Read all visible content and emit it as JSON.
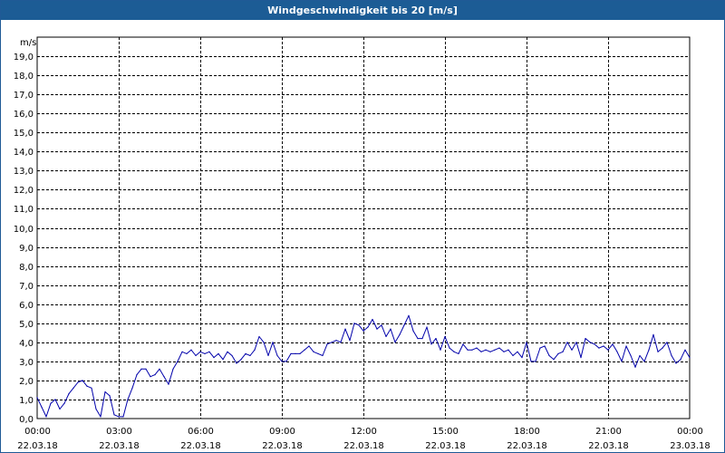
{
  "window": {
    "title": "Windgeschwindigkeit bis 20 [m/s]"
  },
  "chart_data": {
    "type": "line",
    "title": "Windgeschwindigkeit bis 20 [m/s]",
    "ylabel": "m/s",
    "xlabel": "",
    "ylim": [
      0,
      20
    ],
    "xlim": [
      "22.03.18 00:00",
      "23.03.18 00:00"
    ],
    "grid": true,
    "y_ticks": [
      "0,0",
      "1,0",
      "2,0",
      "3,0",
      "4,0",
      "5,0",
      "6,0",
      "7,0",
      "8,0",
      "9,0",
      "10,0",
      "11,0",
      "12,0",
      "13,0",
      "14,0",
      "15,0",
      "16,0",
      "17,0",
      "18,0",
      "19,0"
    ],
    "x_ticks": [
      {
        "time": "00:00",
        "date": "22.03.18"
      },
      {
        "time": "03:00",
        "date": "22.03.18"
      },
      {
        "time": "06:00",
        "date": "22.03.18"
      },
      {
        "time": "09:00",
        "date": "22.03.18"
      },
      {
        "time": "12:00",
        "date": "22.03.18"
      },
      {
        "time": "15:00",
        "date": "22.03.18"
      },
      {
        "time": "18:00",
        "date": "22.03.18"
      },
      {
        "time": "21:00",
        "date": "22.03.18"
      },
      {
        "time": "00:00",
        "date": "23.03.18"
      }
    ],
    "line_color": "#0000aa",
    "grid_color": "#000000",
    "series": [
      {
        "x": [
          "00:00",
          "00:10",
          "00:20",
          "00:30",
          "00:40",
          "00:50",
          "01:00",
          "01:10",
          "01:20",
          "01:30",
          "01:40",
          "01:50",
          "02:00",
          "02:10",
          "02:20",
          "02:30",
          "02:40",
          "02:50",
          "03:00",
          "03:10",
          "03:20",
          "03:30",
          "03:40",
          "03:50",
          "04:00",
          "04:10",
          "04:20",
          "04:30",
          "04:40",
          "04:50",
          "05:00",
          "05:10",
          "05:20",
          "05:30",
          "05:40",
          "05:50",
          "06:00",
          "06:10",
          "06:20",
          "06:30",
          "06:40",
          "06:50",
          "07:00",
          "07:10",
          "07:20",
          "07:30",
          "07:40",
          "07:50",
          "08:00",
          "08:10",
          "08:20",
          "08:30",
          "08:40",
          "08:50",
          "09:00",
          "09:10",
          "09:20",
          "09:30",
          "09:40",
          "09:50",
          "10:00",
          "10:10",
          "10:20",
          "10:30",
          "10:40",
          "10:50",
          "11:00",
          "11:10",
          "11:20",
          "11:30",
          "11:40",
          "11:50",
          "12:00",
          "12:10",
          "12:20",
          "12:30",
          "12:40",
          "12:50",
          "13:00",
          "13:10",
          "13:20",
          "13:30",
          "13:40",
          "13:50",
          "14:00",
          "14:10",
          "14:20",
          "14:30",
          "14:40",
          "14:50",
          "15:00",
          "15:10",
          "15:20",
          "15:30",
          "15:40",
          "15:50",
          "16:00",
          "16:10",
          "16:20",
          "16:30",
          "16:40",
          "16:50",
          "17:00",
          "17:10",
          "17:20",
          "17:30",
          "17:40",
          "17:50",
          "18:00",
          "18:10",
          "18:20",
          "18:30",
          "18:40",
          "18:50",
          "19:00",
          "19:10",
          "19:20",
          "19:30",
          "19:40",
          "19:50",
          "20:00",
          "20:10",
          "20:20",
          "20:30",
          "20:40",
          "20:50",
          "21:00",
          "21:10",
          "21:20",
          "21:30",
          "21:40",
          "21:50",
          "22:00",
          "22:10",
          "22:20",
          "22:30",
          "22:40",
          "22:50",
          "23:00",
          "23:10",
          "23:20",
          "23:30",
          "23:40",
          "23:50",
          "24:00"
        ],
        "values": [
          1.1,
          0.6,
          0.1,
          0.8,
          1.0,
          0.5,
          0.8,
          1.3,
          1.6,
          1.9,
          2.0,
          1.7,
          1.6,
          0.5,
          0.1,
          1.4,
          1.2,
          0.2,
          0.1,
          0.1,
          1.0,
          1.6,
          2.3,
          2.6,
          2.6,
          2.2,
          2.3,
          2.6,
          2.2,
          1.8,
          2.6,
          3.0,
          3.5,
          3.4,
          3.6,
          3.3,
          3.5,
          3.4,
          3.5,
          3.2,
          3.4,
          3.1,
          3.5,
          3.3,
          2.9,
          3.1,
          3.4,
          3.3,
          3.6,
          4.3,
          4.0,
          3.3,
          4.0,
          3.3,
          3.0,
          3.0,
          3.4,
          3.4,
          3.4,
          3.6,
          3.8,
          3.5,
          3.4,
          3.3,
          3.9,
          4.0,
          4.1,
          4.0,
          4.7,
          4.1,
          5.0,
          4.9,
          4.6,
          4.8,
          5.2,
          4.7,
          4.9,
          4.3,
          4.7,
          4.0,
          4.4,
          4.9,
          5.4,
          4.6,
          4.2,
          4.2,
          4.8,
          3.9,
          4.2,
          3.6,
          4.3,
          3.7,
          3.5,
          3.4,
          3.9,
          3.6,
          3.6,
          3.7,
          3.5,
          3.6,
          3.5,
          3.6,
          3.7,
          3.5,
          3.6,
          3.3,
          3.5,
          3.2,
          4.0,
          3.0,
          3.0,
          3.7,
          3.8,
          3.3,
          3.1,
          3.4,
          3.5,
          4.0,
          3.6,
          4.0,
          3.2,
          4.2,
          4.0,
          3.9,
          3.7,
          3.8,
          3.6,
          3.9,
          3.5,
          3.0,
          3.8,
          3.3,
          2.7,
          3.3,
          3.0,
          3.6,
          4.4,
          3.5,
          3.7,
          4.0,
          3.3,
          2.9,
          3.1,
          3.6,
          3.2
        ]
      }
    ]
  }
}
